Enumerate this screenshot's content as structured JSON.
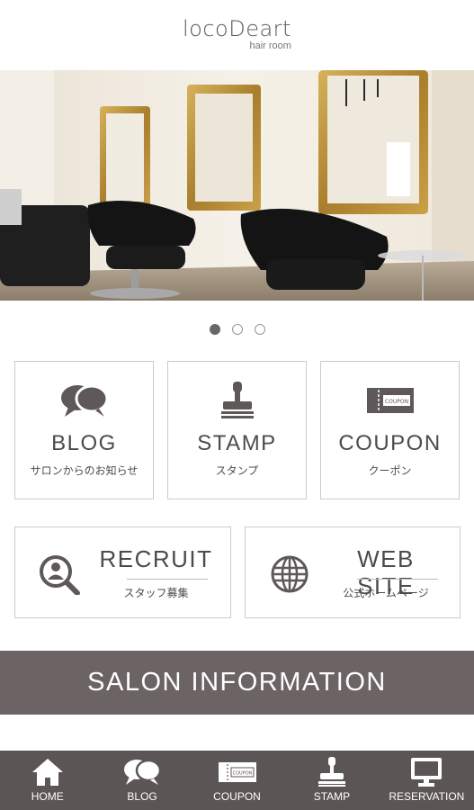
{
  "header": {
    "logo_main": "locoDeart",
    "logo_sub": "hair room"
  },
  "hero": {
    "image_desc": "salon-interior-photo"
  },
  "carousel": {
    "count": 3,
    "active_index": 0
  },
  "tiles": [
    {
      "title": "BLOG",
      "sub": "サロンからのお知らせ",
      "icon": "chat-bubbles-icon"
    },
    {
      "title": "STAMP",
      "sub": "スタンプ",
      "icon": "stamp-icon"
    },
    {
      "title": "COUPON",
      "sub": "クーポン",
      "icon": "coupon-icon"
    }
  ],
  "wide_tiles": [
    {
      "title": "RECRUIT",
      "sub": "スタッフ募集",
      "icon": "search-person-icon"
    },
    {
      "title": "WEB SITE",
      "sub": "公式ホームページ",
      "icon": "globe-icon"
    }
  ],
  "salon_button": {
    "label": "SALON INFORMATION"
  },
  "tabbar": {
    "items": [
      {
        "label": "HOME",
        "icon": "home-icon"
      },
      {
        "label": "BLOG",
        "icon": "chat-bubbles-icon"
      },
      {
        "label": "COUPON",
        "icon": "coupon-icon"
      },
      {
        "label": "STAMP",
        "icon": "stamp-icon"
      },
      {
        "label": "RESERVATION",
        "icon": "monitor-icon"
      }
    ]
  },
  "colors": {
    "brand_dark": "#6c6464",
    "tabbar_bg": "#5c5555",
    "text": "#4f4a4a",
    "border": "#cfcaca"
  }
}
